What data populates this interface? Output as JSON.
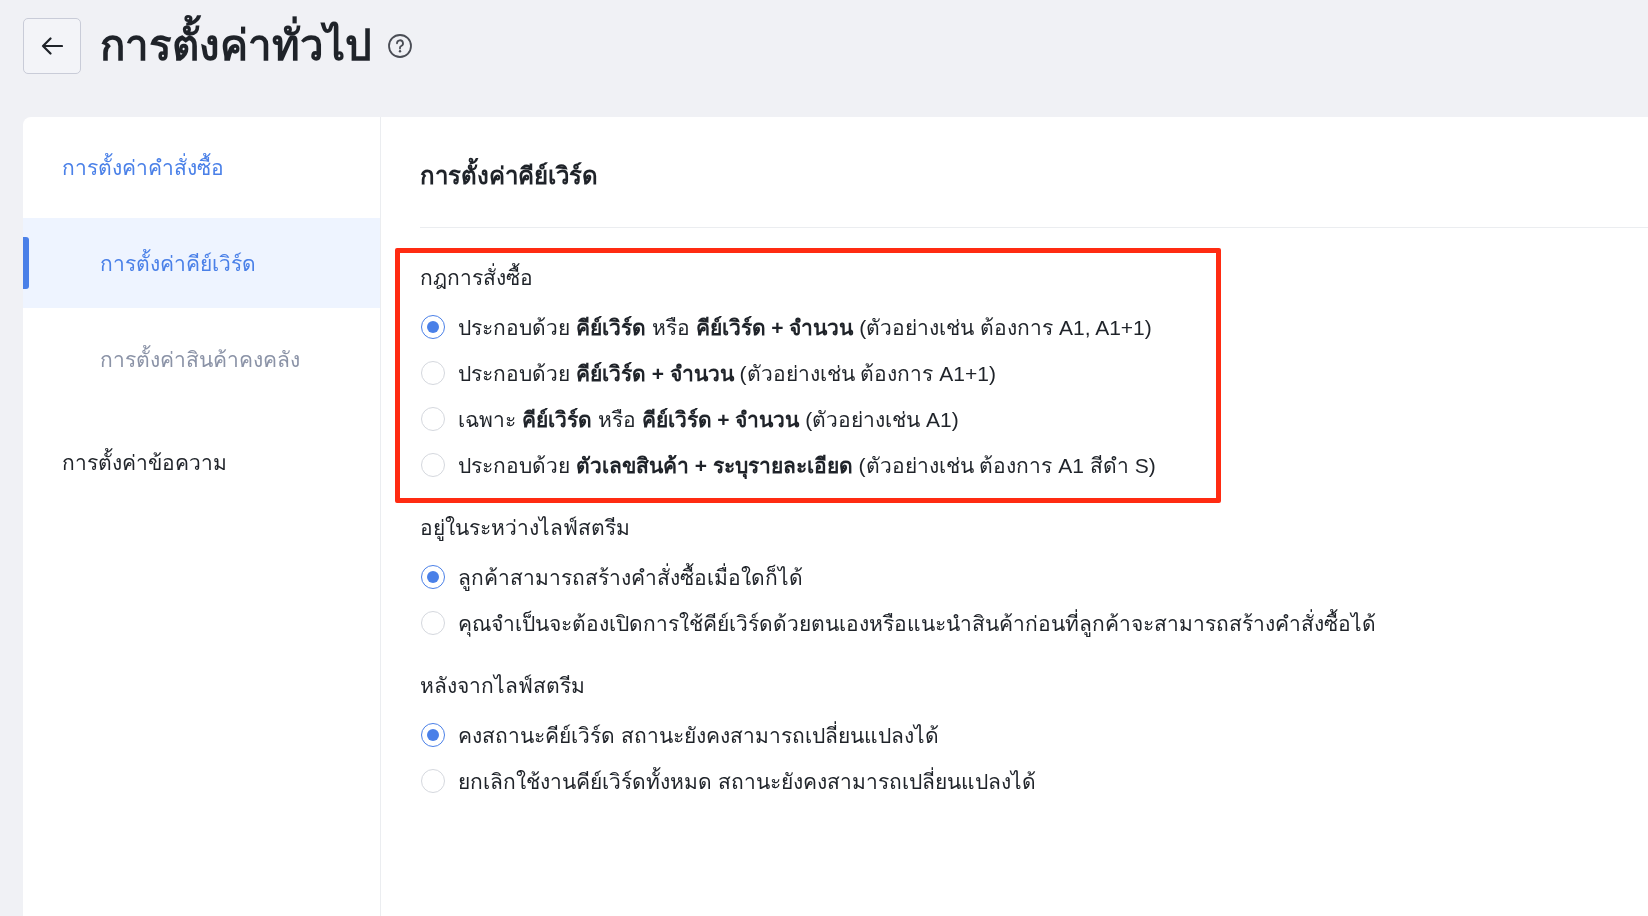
{
  "header": {
    "title": "การตั้งค่าทั่วไป"
  },
  "sidebar": {
    "items": [
      {
        "label": "การตั้งค่าคำสั่งซื้อ",
        "selected": false,
        "children": [
          {
            "label": "การตั้งค่าคีย์เวิร์ด",
            "selected": true
          },
          {
            "label": "การตั้งค่าสินค้าคงคลัง",
            "selected": false
          }
        ]
      },
      {
        "label": "การตั้งค่าข้อความ",
        "selected": false
      }
    ]
  },
  "content": {
    "title": "การตั้งค่าคีย์เวิร์ด",
    "groups": [
      {
        "label": "กฎการสั่งซื้อ",
        "highlighted": true,
        "options": [
          {
            "label": "ประกอบด้วย **คีย์เวิร์ด** หรือ **คีย์เวิร์ด + จำนวน** (ตัวอย่างเช่น ต้องการ A1, A1+1)",
            "selected": true
          },
          {
            "label": "ประกอบด้วย **คีย์เวิร์ด + จำนวน** (ตัวอย่างเช่น ต้องการ A1+1)",
            "selected": false
          },
          {
            "label": "เฉพาะ **คีย์เวิร์ด** หรือ **คีย์เวิร์ด + จำนวน** (ตัวอย่างเช่น A1)",
            "selected": false
          },
          {
            "label": "ประกอบด้วย **ตัวเลขสินค้า + ระบุรายละเอียด** (ตัวอย่างเช่น ต้องการ A1 สีดำ S)",
            "selected": false
          }
        ]
      },
      {
        "label": "อยู่ในระหว่างไลฟ์สตรีม",
        "highlighted": false,
        "options": [
          {
            "label": "ลูกค้าสามารถสร้างคำสั่งซื้อเมื่อใดก็ได้",
            "selected": true
          },
          {
            "label": "คุณจำเป็นจะต้องเปิดการใช้คีย์เวิร์ดด้วยตนเองหรือแนะนำสินค้าก่อนที่ลูกค้าจะสามารถสร้างคำสั่งซื้อได้",
            "selected": false
          }
        ]
      },
      {
        "label": "หลังจากไลฟ์สตรีม",
        "highlighted": false,
        "options": [
          {
            "label": "คงสถานะคีย์เวิร์ด สถานะยังคงสามารถเปลี่ยนแปลงได้",
            "selected": true
          },
          {
            "label": "ยกเลิกใช้งานคีย์เวิร์ดทั้งหมด สถานะยังคงสามารถเปลี่ยนแปลงได้",
            "selected": false
          }
        ]
      }
    ]
  }
}
